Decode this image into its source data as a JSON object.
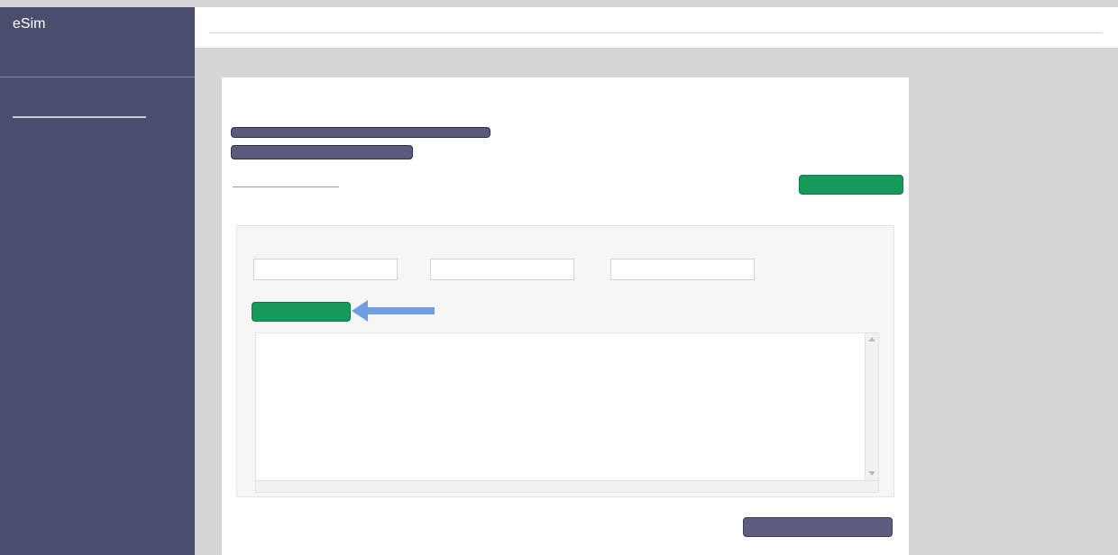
{
  "colors": {
    "sidebar_bg": "#4a4d6e",
    "accent_green": "#169a5c",
    "accent_purple": "#5d5d82",
    "accent_arrow": "#6f9fe0",
    "page_bg": "#d6d6d6"
  },
  "icons": {
    "annotation_arrow": "left-arrow-icon"
  },
  "sidebar": {
    "logo": "eSim"
  }
}
